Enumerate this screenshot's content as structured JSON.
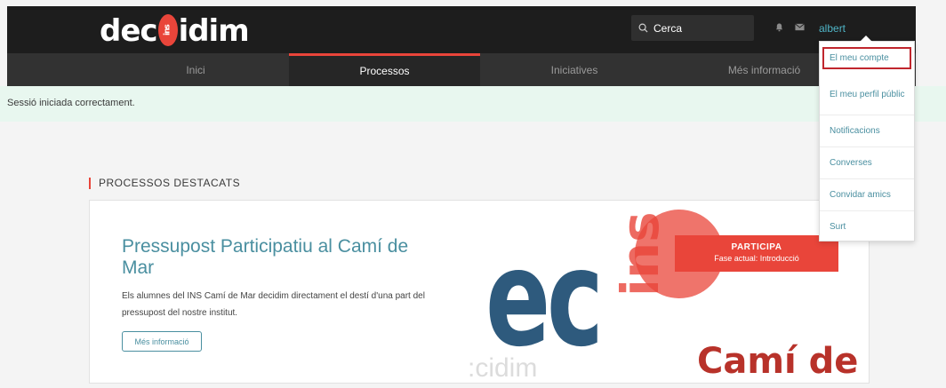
{
  "header": {
    "logo": {
      "part1": "dec",
      "mark": "ins",
      "part2": "idim"
    },
    "search": {
      "placeholder": "Cerca"
    },
    "user": "albert"
  },
  "nav": {
    "items": [
      {
        "label": "Inici"
      },
      {
        "label": "Processos",
        "active": true
      },
      {
        "label": "Iniciatives"
      },
      {
        "label": "Més informació"
      }
    ]
  },
  "callout": {
    "text": "Sessió iniciada correctament."
  },
  "section": {
    "title": "PROCESSOS DESTACATS"
  },
  "card": {
    "title": "Pressupost Participatiu al Camí de Mar",
    "description": "Els alumnes del INS Camí de Mar decidim directament el destí d'una part del pressupost del nostre institut.",
    "button": "Més informació",
    "hero": {
      "word": "ec",
      "ins": "ins",
      "faint": ":cidim",
      "cami": "Camí de M"
    },
    "cta": {
      "title": "PARTICIPA",
      "phase": "Fase actual: Introducció"
    }
  },
  "dropdown": {
    "items": [
      {
        "label": "El meu compte",
        "highlighted": true
      },
      {
        "label": "El meu perfil públic"
      },
      {
        "label": "Notificacions"
      },
      {
        "label": "Converses"
      },
      {
        "label": "Convidar amics"
      },
      {
        "label": "Surt"
      }
    ]
  },
  "colors": {
    "accent": "#e9453a",
    "link": "#4a8fa0",
    "header_bg": "#1d1d1d",
    "nav_bg": "#323232",
    "success_bg": "#e8f7ef"
  }
}
